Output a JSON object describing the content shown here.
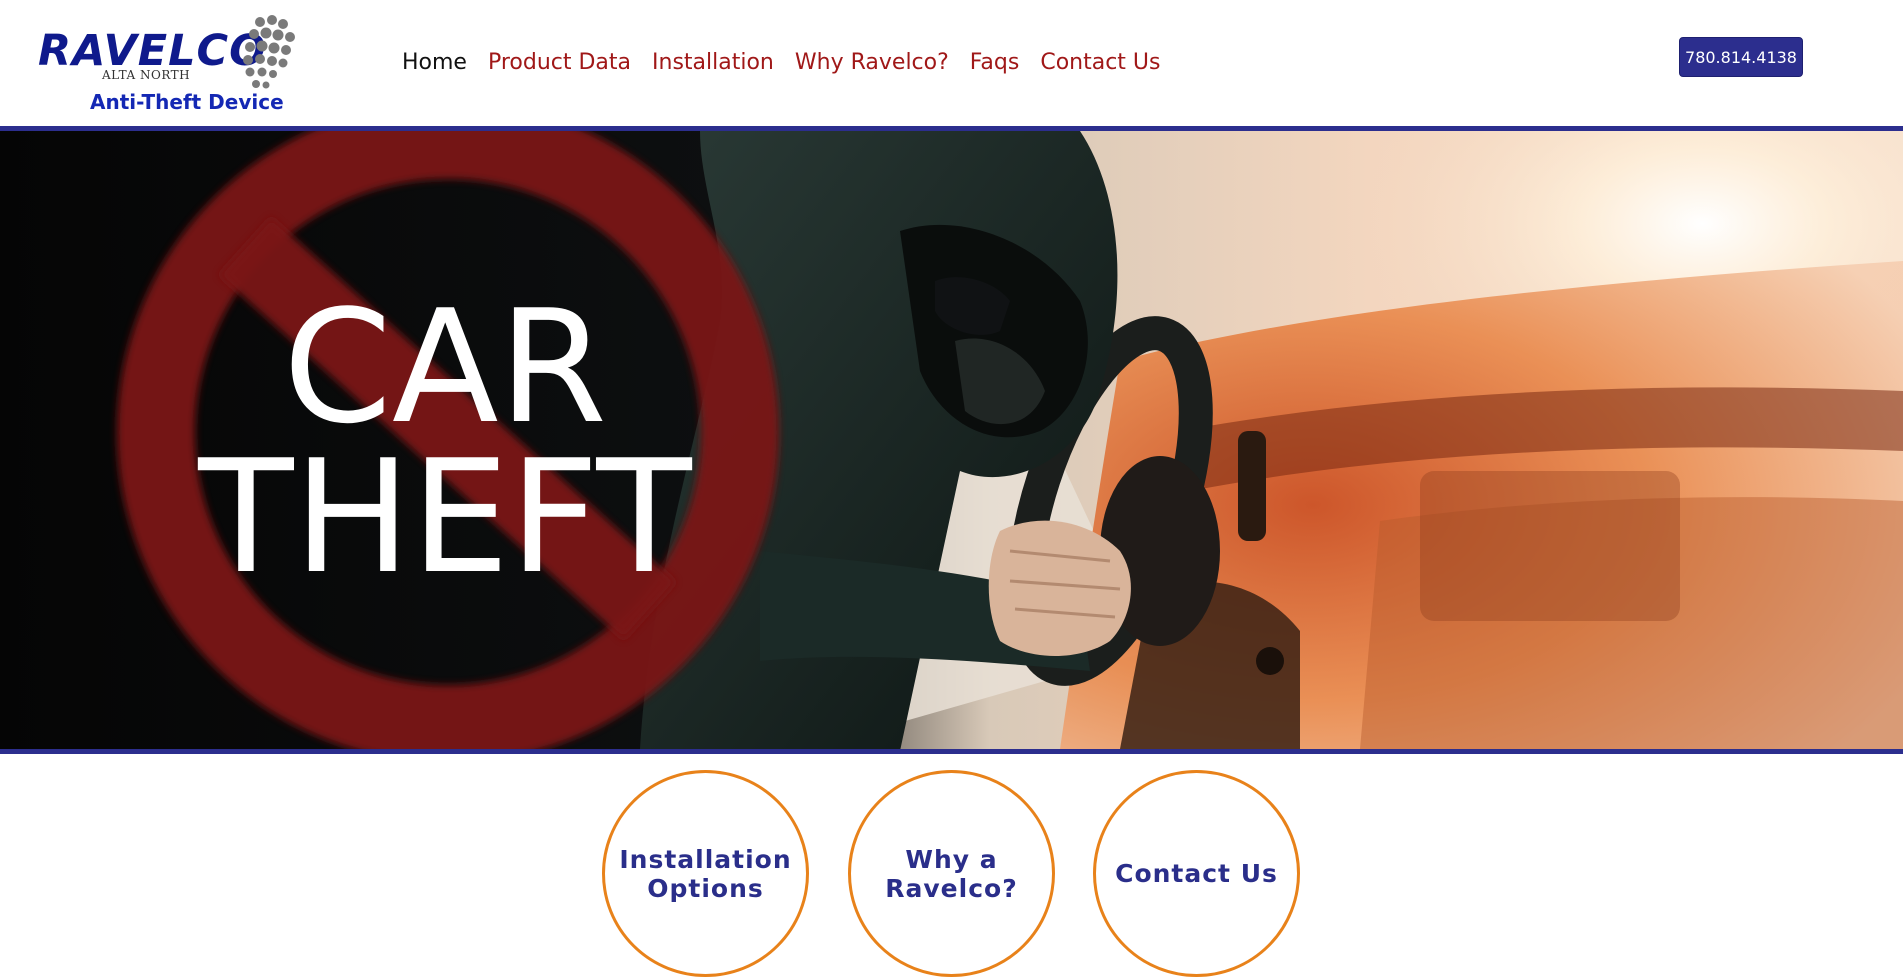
{
  "logo": {
    "word": "RAVELCO",
    "sub": "ALTA NORTH",
    "tagline": "Anti-Theft Device",
    "icon": "dot-cluster-icon"
  },
  "nav": {
    "items": [
      {
        "label": "Home",
        "active": true
      },
      {
        "label": "Product Data",
        "active": false
      },
      {
        "label": "Installation",
        "active": false
      },
      {
        "label": "Why Ravelco?",
        "active": false
      },
      {
        "label": "Faqs",
        "active": false
      },
      {
        "label": "Contact Us",
        "active": false
      }
    ]
  },
  "phone": {
    "label": "780.814.4138"
  },
  "hero": {
    "line1": "CAR",
    "line2": "THEFT",
    "icon": "no-symbol-icon"
  },
  "cards": [
    {
      "label": "Installation Options"
    },
    {
      "label": "Why a Ravelco?"
    },
    {
      "label": "Contact Us"
    }
  ],
  "colors": {
    "brand_blue": "#2c2e8e",
    "nav_red": "#a01818",
    "circle_orange": "#e8821a",
    "no_symbol_red": "#8a1616"
  }
}
